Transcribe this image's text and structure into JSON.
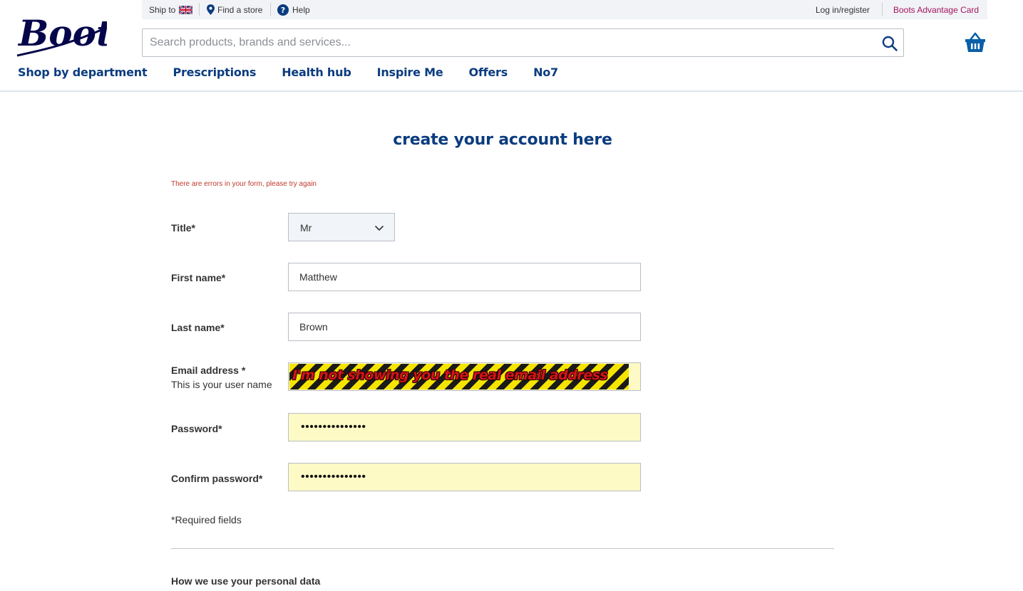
{
  "brand": {
    "logo_text": "Boots",
    "logo_color": "#05054b",
    "accent": "#0b3c7f",
    "advantage_color": "#a4145f"
  },
  "topbar": {
    "ship_to_label": "Ship to",
    "find_store_label": "Find a store",
    "help_label": "Help",
    "login_label": "Log in/register",
    "advantage_label": "Boots Advantage Card"
  },
  "search": {
    "placeholder": "Search products, brands and services..."
  },
  "nav": {
    "items": [
      "Shop by department",
      "Prescriptions",
      "Health hub",
      "Inspire Me",
      "Offers",
      "No7"
    ]
  },
  "page": {
    "title": "create your account here",
    "form_error": "There are errors in your form, please try again"
  },
  "form": {
    "title_label": "Title*",
    "title_value": "Mr",
    "first_name_label": "First name*",
    "first_name_value": "Matthew",
    "last_name_label": "Last name*",
    "last_name_value": "Brown",
    "email_label": "Email address *",
    "email_sublabel": "This is your user name",
    "email_overlay_text": "I'm not showing you the real email address",
    "password_label": "Password*",
    "password_masked": "•••••••••••••••",
    "confirm_label": "Confirm password*",
    "confirm_masked": "•••••••••••••••",
    "required_note": "*Required fields",
    "section_title": "How we use your personal data"
  }
}
